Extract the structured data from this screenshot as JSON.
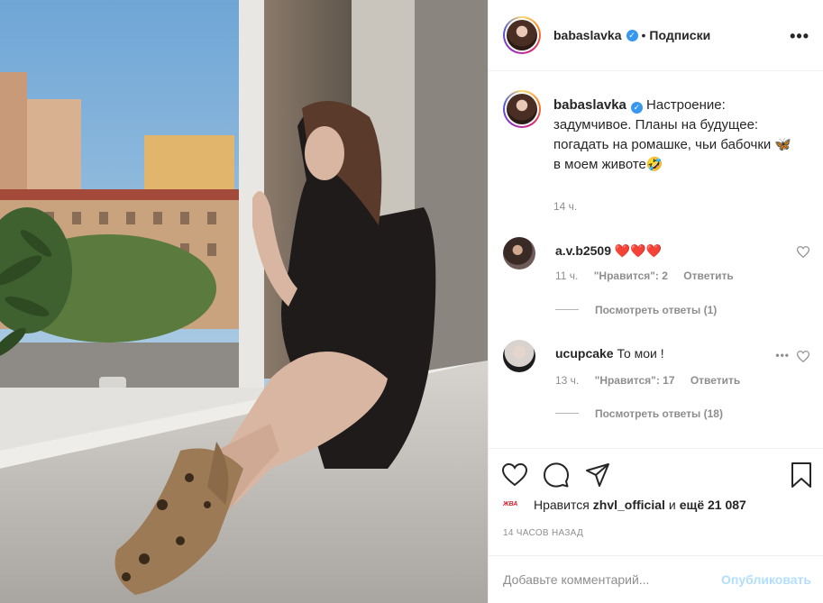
{
  "post": {
    "username": "babaslavka",
    "verified_mark": "✓",
    "separator": "•",
    "follow_label": "Подписки",
    "more_label": "•••"
  },
  "caption": {
    "username": "babaslavka",
    "text": " Настроение: задумчивое. Планы на будущее: погадать на ромашке, чьи бабочки 🦋 в моем животе🤣",
    "time": "14 ч."
  },
  "comments": [
    {
      "username": "a.v.b2509",
      "text": "❤️❤️❤️",
      "time": "11 ч.",
      "likes": "\"Нравится\": 2",
      "reply_label": "Ответить",
      "view_replies": "Посмотреть ответы (1)"
    },
    {
      "username": "ucupcake",
      "text": "То мои !",
      "time": "13 ч.",
      "likes": "\"Нравится\": 17",
      "reply_label": "Ответить",
      "view_replies": "Посмотреть ответы (18)"
    }
  ],
  "icons": {
    "like": "heart-icon",
    "comment": "comment-icon",
    "share": "share-icon",
    "save": "bookmark-icon",
    "comment_like": "small-heart-icon",
    "comment_options": "options-dots-icon"
  },
  "likes": {
    "liker_badge": "ЖВА",
    "prefix": "Нравится ",
    "liker": "zhvl_official",
    "middle": " и ",
    "count": "ещё 21 087"
  },
  "timestamp": "14 ЧАСОВ НАЗАД",
  "add_comment": {
    "placeholder": "Добавьте комментарий...",
    "publish_label": "Опубликовать"
  },
  "colors": {
    "accent": "#3897f0",
    "publish_disabled": "#b2dffc",
    "muted": "#8e8e8e",
    "heart_red": "#ed4956"
  }
}
